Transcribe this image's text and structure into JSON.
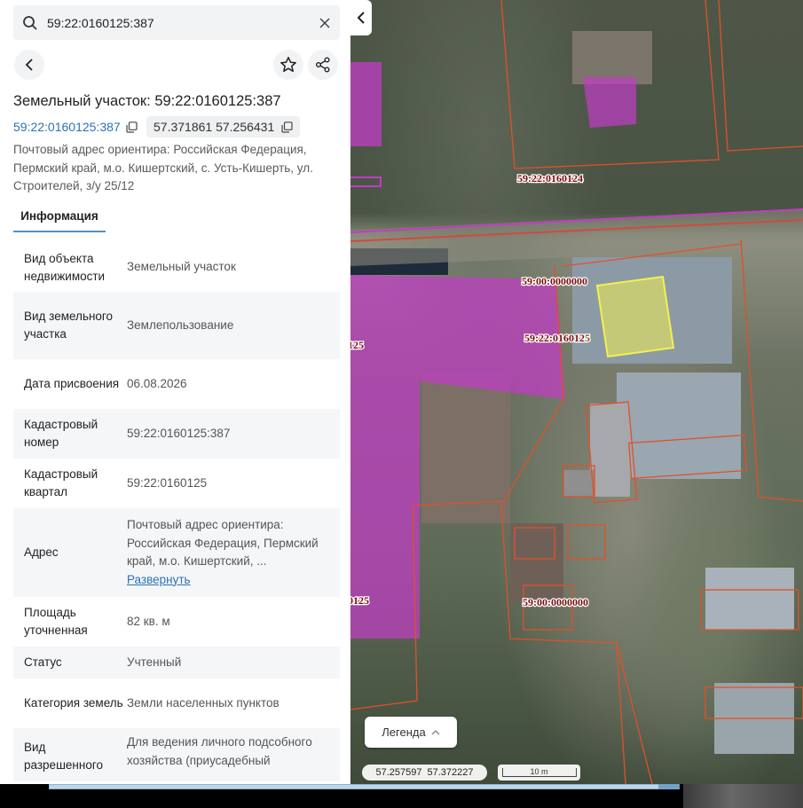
{
  "search": {
    "value": "59:22:0160125:387",
    "placeholder": ""
  },
  "panel": {
    "title": "Земельный участок: 59:22:0160125:387",
    "cadastral_chip": "59:22:0160125:387",
    "coords_chip": "57.371861 57.256431",
    "address": "Почтовый адрес ориентира: Российская Федерация, Пермский край, м.о. Кишертский, с. Усть-Кишерть, ул. Строителей, з/у 25/12",
    "tab": "Информация",
    "rows": [
      {
        "key": "Вид объекта недвижимости",
        "value": "Земельный участок"
      },
      {
        "key": "Вид земельного участка",
        "value": "Землепользование"
      },
      {
        "key": "Дата присвоения",
        "value": "06.08.2026"
      },
      {
        "key": "Кадастровый номер",
        "value": "59:22:0160125:387"
      },
      {
        "key": "Кадастровый квартал",
        "value": "59:22:0160125"
      },
      {
        "key": "Адрес",
        "value": "Почтовый адрес ориентира: Российская Федерация, Пермский край, м.о. Кишертский, ...",
        "link": "Развернуть"
      },
      {
        "key": "Площадь уточненная",
        "value": "82 кв. м"
      },
      {
        "key": "Статус",
        "value": "Учтенный"
      },
      {
        "key": "Категория земель",
        "value": "Земли населенных пунктов"
      },
      {
        "key": "Вид разрешенного",
        "value": "Для ведения личного подсобного хозяйства (приусадебный"
      }
    ]
  },
  "map": {
    "labels": {
      "q124": "59:22:0160124",
      "zero_top": "59:00:0000000",
      "q125": "59:22:016012",
      "q125_digit": "5",
      "left_frag1": "125",
      "zero_bottom": "59:00:0000000",
      "left_frag2": "0125"
    },
    "legend_label": "Легенда",
    "cursor_coords": [
      "57.257597",
      "57.372227"
    ],
    "scale_label": "10 m",
    "colors": {
      "parcel_selected": "#f2f050",
      "zone_fill": "#c23cc6",
      "boundary": "#e0502a",
      "label": "#7a0d0d"
    }
  }
}
